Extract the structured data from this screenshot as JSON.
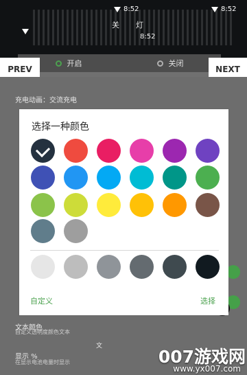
{
  "top": {
    "status_time": "8:52",
    "small_title": "关",
    "small_title_2": "灯"
  },
  "segmented": {
    "on_label": "开启",
    "off_label": "关闭"
  },
  "navigation": {
    "prev_label": "PREV",
    "next_label": "NEXT"
  },
  "background_settings": {
    "charging_animation": "充电动画：交流充电",
    "text_color": "文本颜色",
    "text_color_sub": "自定义透明度颜色文本",
    "display_percent": "显示 %",
    "display_percent_sub": "在显示电池电量时显示",
    "footer_mark": "文"
  },
  "dialog": {
    "title": "选择一种颜色",
    "custom_label": "自定义",
    "choose_label": "选择",
    "colors": {
      "row1": [
        "#24313f",
        "#ef4b3f",
        "#e91e63",
        "#e73ea9",
        "#9c27b0",
        "#6f42c1"
      ],
      "row2": [
        "#3f51b5",
        "#2196f3",
        "#03a9f4",
        "#00bcd4",
        "#009688",
        "#4caf50"
      ],
      "row3": [
        "#8bc34a",
        "#cddc39",
        "#ffeb3b",
        "#ffc107",
        "#ff9800",
        "#795548"
      ],
      "row4": [
        "#607d8b",
        "#9e9e9e"
      ],
      "row5": [
        "#e6e6e6",
        "#bdbdbd",
        "#8f9499",
        "#646b70",
        "#3f4a4f",
        "#111a20"
      ]
    }
  },
  "watermark": {
    "brand": "007游戏网",
    "url": "www.yx007.com"
  }
}
